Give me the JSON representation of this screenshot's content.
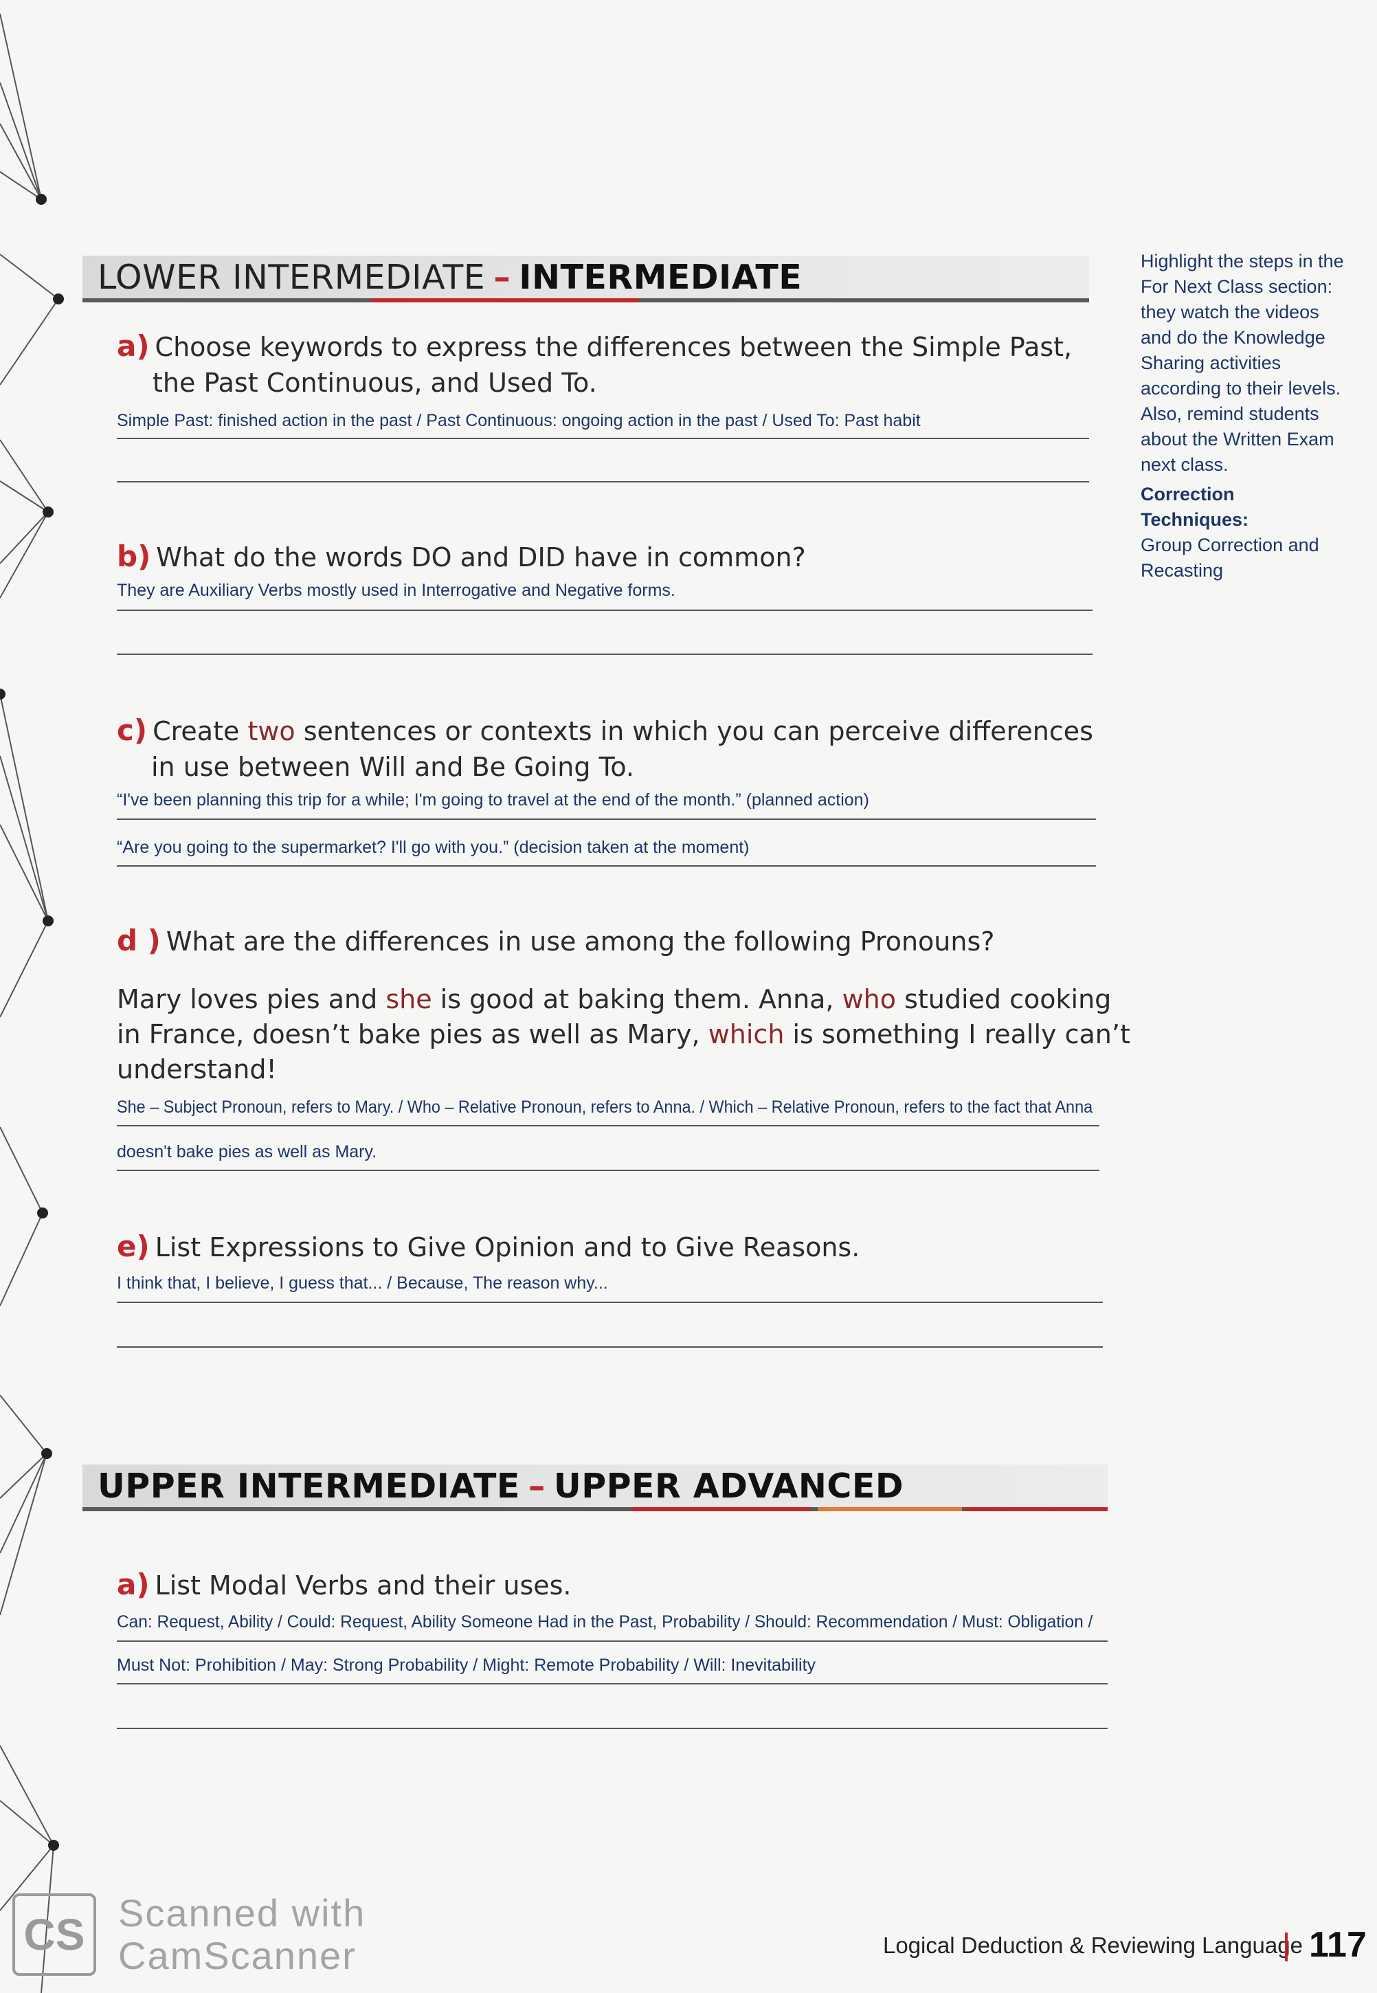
{
  "sections": {
    "lower": {
      "level_left": "LOWER INTERMEDIATE",
      "dash": "–",
      "level_right": "INTERMEDIATE"
    },
    "upper": {
      "level_left": "UPPER INTERMEDIATE",
      "dash": "–",
      "level_right": "UPPER ADVANCED"
    }
  },
  "questions": {
    "a": {
      "letter": "a)",
      "line1": "Choose keywords to express the differences between the Simple Past,",
      "line2": "the Past Continuous, and Used To.",
      "answer1": "Simple Past: finished action in the past / Past Continuous: ongoing action in the past / Used To: Past habit"
    },
    "b": {
      "letter": "b)",
      "text": "What do the words DO and DID have in common?",
      "answer1": "They are Auxiliary Verbs mostly used in Interrogative and Negative forms."
    },
    "c": {
      "letter": "c)",
      "line1_pre": "Create ",
      "line1_hl": "two",
      "line1_post": " sentences or contexts in which you can perceive differences",
      "line2": "in use between Will and Be Going To.",
      "answer1": "“I've been planning this trip for a while; I'm going to travel at the end of the month.” (planned action)",
      "answer2": "“Are you going to the supermarket? I'll go with you.” (decision taken at the moment)"
    },
    "d": {
      "letter": "d )",
      "text": "What are the differences in use among the following Pronouns?",
      "p1_pre": "Mary loves pies and ",
      "p1_hl": "she",
      "p1_post": " is good at baking them. Anna, ",
      "p1_hl2": "who",
      "p1_post2": " studied cooking",
      "p2_pre": "in France, doesn’t bake pies as well as Mary, ",
      "p2_hl": "which",
      "p2_post": " is something I really can’t",
      "p3": "understand!",
      "answer1": "She – Subject Pronoun, refers to Mary. / Who – Relative Pronoun, refers to Anna. / Which – Relative Pronoun, refers to the fact that Anna",
      "answer2": "doesn't bake pies as well as Mary."
    },
    "e": {
      "letter": "e)",
      "text": "List Expressions to Give Opinion and to Give Reasons.",
      "answer1": "I think that, I believe, I guess that... / Because, The reason why..."
    },
    "ua": {
      "letter": "a)",
      "text": "List Modal Verbs and their uses.",
      "answer1": "Can: Request, Ability / Could: Request, Ability Someone Had in the Past, Probability / Should: Recommendation / Must: Obligation /",
      "answer2": "Must Not: Prohibition / May: Strong Probability / Might: Remote Probability / Will: Inevitability"
    }
  },
  "sidebar": {
    "note_lines": [
      "Highlight the steps in the",
      "For Next Class section:",
      "they watch the videos",
      "and do the Knowledge",
      "Sharing activities",
      "according to their levels.",
      "Also, remind students",
      "about the Written Exam",
      "next class."
    ],
    "techniques_label": "Correction Techniques:",
    "techniques_lines": [
      "Group Correction and",
      "Recasting"
    ]
  },
  "footer": {
    "chapter": "Logical Deduction & Reviewing Language",
    "page": "117"
  },
  "watermark": {
    "logo": "CS",
    "line1": "Scanned with",
    "line2": "CamScanner"
  },
  "colors": {
    "accent": "#c0282f",
    "answer": "#1d3567",
    "highlight": "#8b2a2a"
  }
}
